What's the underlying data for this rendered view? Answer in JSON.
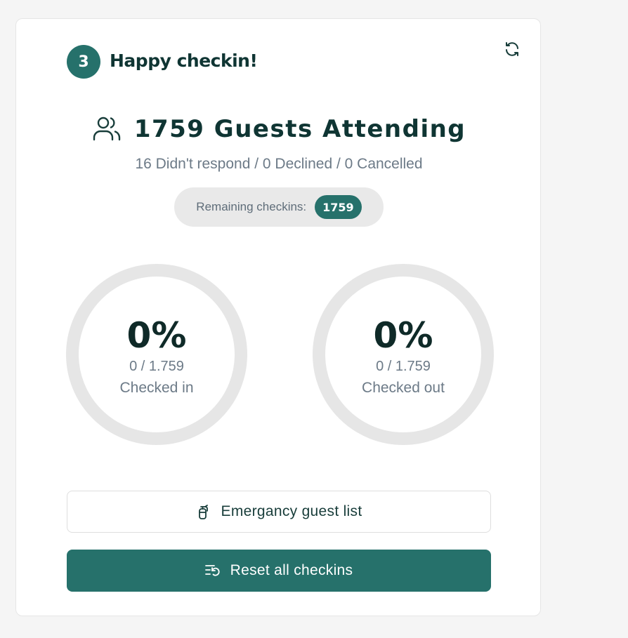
{
  "step": {
    "number": "3",
    "title": "Happy checkin!"
  },
  "refresh": {
    "icon": "refresh-icon"
  },
  "summary": {
    "icon": "users-icon",
    "headline": "1759 Guests Attending",
    "subline": "16 Didn't respond / 0 Declined / 0 Cancelled"
  },
  "remaining": {
    "label": "Remaining checkins:",
    "count": "1759"
  },
  "rings": {
    "checked_in": {
      "percent": "0%",
      "fraction": "0 / 1.759",
      "label": "Checked in",
      "progress": 0
    },
    "checked_out": {
      "percent": "0%",
      "fraction": "0 / 1.759",
      "label": "Checked out",
      "progress": 0
    }
  },
  "buttons": {
    "emergency_label": "Emergancy guest list",
    "emergency_icon": "fire-extinguisher-icon",
    "reset_label": "Reset all checkins",
    "reset_icon": "reset-list-icon"
  },
  "colors": {
    "accent": "#26716b",
    "ring_track": "#e6e6e6",
    "heading": "#0f3533"
  }
}
